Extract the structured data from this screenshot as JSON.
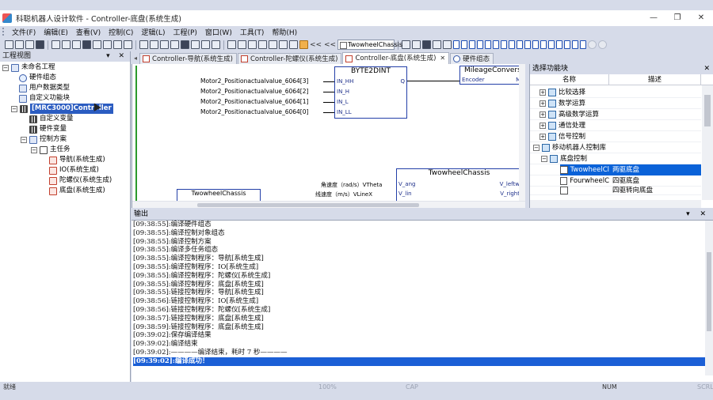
{
  "window": {
    "title": "科聪机器人设计软件 - Controller-底盘(系统生成)",
    "buttons": {
      "minimize": "—",
      "restore": "❐",
      "close": "✕"
    }
  },
  "menu": [
    "文件(F)",
    "编辑(E)",
    "查看(V)",
    "控制(C)",
    "逻辑(L)",
    "工程(P)",
    "窗口(W)",
    "工具(T)",
    "帮助(H)"
  ],
  "toolbar": {
    "combo_value": "TwowheelChassis",
    "nav_arrows": "<< <<"
  },
  "project_panel": {
    "title": "工程视图",
    "controls": "▾ ✕",
    "tree": [
      {
        "label": "未命名工程",
        "toggle": "−"
      },
      {
        "label": "硬件组态"
      },
      {
        "label": "用户数据类型"
      },
      {
        "label": "自定义功能块"
      },
      {
        "label": "[MRC3000]Controller",
        "toggle": "−"
      },
      {
        "label": "自定义变量"
      },
      {
        "label": "硬件变量"
      },
      {
        "label": "控制方案",
        "toggle": "−"
      },
      {
        "label": "主任务",
        "toggle": "−"
      },
      {
        "label": "导航(系统生成)"
      },
      {
        "label": "IO(系统生成)"
      },
      {
        "label": "陀螺仪(系统生成)"
      },
      {
        "label": "底盘(系统生成)"
      }
    ]
  },
  "editor_tabs": {
    "nav": "◂",
    "tabs": [
      {
        "label": "Controller-导航(系统生成)"
      },
      {
        "label": "Controller-陀螺仪(系统生成)"
      },
      {
        "label": "Controller-底盘(系统生成)",
        "close": "✕"
      },
      {
        "label": "硬件组态"
      }
    ]
  },
  "diagram": {
    "inputs": [
      "Motor2_Positionactualvalue_6064[3]",
      "Motor2_Positionactualvalue_6064[2]",
      "Motor2_Positionactualvalue_6064[1]",
      "Motor2_Positionactualvalue_6064[0]"
    ],
    "byte2dint": {
      "title": "BYTE2DINT",
      "pins_in": [
        "IN_HH",
        "IN_H",
        "IN_L",
        "IN_LL"
      ],
      "pin_out": "Q"
    },
    "mileage": {
      "title": "MileageConvers",
      "pin_in": "Encoder",
      "pin_out": "Mil"
    },
    "chassis": {
      "title": "TwowheelChassis",
      "pins_in": [
        "V_ang",
        "V_lin"
      ],
      "pins_out": [
        "V_leftw",
        "V_right"
      ]
    },
    "chassis_inputs": [
      "角速度（rad/s）VTheta",
      "线速度（m/s）VLineX"
    ],
    "lower_block_title": "TwowheelChassis"
  },
  "function_selector": {
    "title": "选择功能块",
    "close": "✕",
    "columns": [
      "名称",
      "描述"
    ],
    "rows": [
      {
        "name": "比较选择",
        "desc": "",
        "toggle": "+"
      },
      {
        "name": "数学运算",
        "desc": "",
        "toggle": "+"
      },
      {
        "name": "高级数学运算",
        "desc": "",
        "toggle": "+"
      },
      {
        "name": "通信处理",
        "desc": "",
        "toggle": "+"
      },
      {
        "name": "信号控制",
        "desc": "",
        "toggle": "+"
      },
      {
        "name": "移动机器人控制库",
        "desc": "",
        "toggle": "−"
      },
      {
        "name": "底盘控制",
        "desc": "",
        "toggle": "−"
      },
      {
        "name": "TwowheelCl",
        "desc": "两驱底盘",
        "selected": true
      },
      {
        "name": "FourwheelC",
        "desc": "四驱底盘"
      },
      {
        "name": "",
        "desc": "四驱转向底盘"
      }
    ]
  },
  "output": {
    "title": "输出",
    "controls": "▾ ✕",
    "lines": [
      "[09:38:55]:编译硬件组态",
      "[09:38:55]:编译控制对象组态",
      "[09:38:55]:编译控制方案",
      "[09:38:55]:编译多任务组态",
      "[09:38:55]:编译控制程序：导航[系统生成]",
      "[09:38:55]:编译控制程序：IO[系统生成]",
      "[09:38:55]:编译控制程序：陀螺仪[系统生成]",
      "[09:38:55]:编译控制程序：底盘[系统生成]",
      "[09:38:55]:链接控制程序：导航[系统生成]",
      "[09:38:56]:链接控制程序：IO[系统生成]",
      "[09:38:56]:链接控制程序：陀螺仪[系统生成]",
      "[09:38:57]:链接控制程序：底盘[系统生成]",
      "[09:38:59]:链接控制程序：底盘[系统生成]",
      "[09:39:02]:保存编译结果",
      "[09:39:02]:编译结束",
      "[09:39:02]:————编译结束，耗时 7 秒————",
      "[09:39:02]:编译成功！"
    ]
  },
  "status": {
    "ready": "就绪",
    "zoom": "100%",
    "cap": "CAP",
    "num": "NUM",
    "scrl": "SCRL"
  }
}
